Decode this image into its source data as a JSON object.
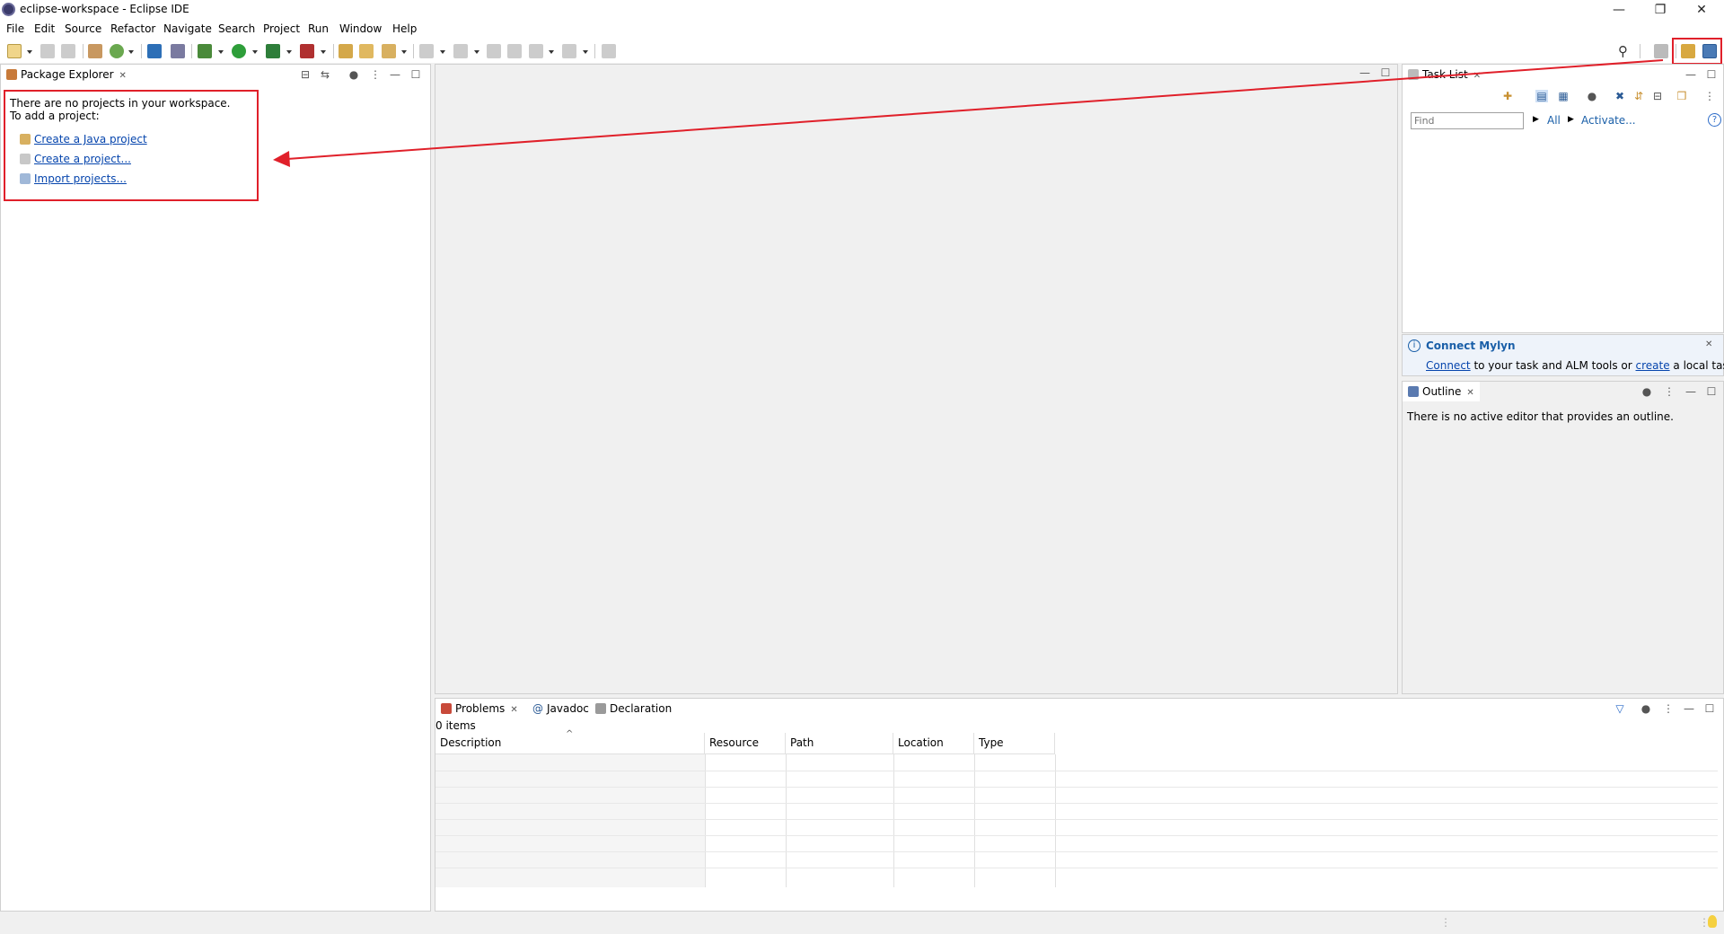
{
  "window": {
    "title": "eclipse-workspace - Eclipse IDE",
    "minimize_glyph": "—",
    "restore_glyph": "❐",
    "close_glyph": "✕"
  },
  "menu": [
    "File",
    "Edit",
    "Source",
    "Refactor",
    "Navigate",
    "Search",
    "Project",
    "Run",
    "Window",
    "Help"
  ],
  "package_explorer": {
    "tab_label": "Package Explorer",
    "message_line1": "There are no projects in your workspace.",
    "message_line2": "To add a project:",
    "links": [
      "Create a Java project",
      "Create a project...",
      "Import projects..."
    ]
  },
  "task_list": {
    "tab_label": "Task List",
    "find_placeholder": "Find",
    "all_label": "All",
    "activate_label": "Activate..."
  },
  "mylyn": {
    "title": "Connect Mylyn",
    "connect_link": "Connect",
    "text_mid": " to your task and ALM tools or ",
    "create_link": "create",
    "text_end": " a local task."
  },
  "outline": {
    "tab_label": "Outline",
    "message": "There is no active editor that provides an outline."
  },
  "bottom": {
    "tabs": [
      "Problems",
      "Javadoc",
      "Declaration"
    ],
    "item_count": "0 items",
    "columns": [
      "Description",
      "Resource",
      "Path",
      "Location",
      "Type"
    ]
  },
  "colors": {
    "accent_red": "#e0202a",
    "link_blue": "#0645ad",
    "mylyn_blue": "#1a5fa8"
  }
}
